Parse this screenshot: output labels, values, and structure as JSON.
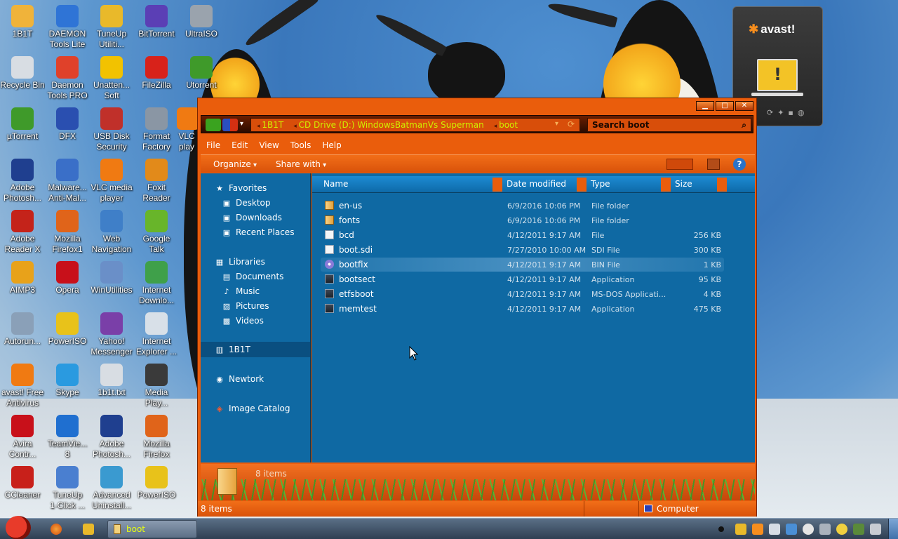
{
  "desktop_icons": [
    {
      "label": "1B1T"
    },
    {
      "label": "DAEMON\nTools Lite"
    },
    {
      "label": "TuneUp\nUtiliti..."
    },
    {
      "label": "BitTorrent"
    },
    {
      "label": "UltraISO"
    },
    {
      "label": "Recycle Bin"
    },
    {
      "label": "Daemon\nTools PRO"
    },
    {
      "label": "Unatten...\nSoft"
    },
    {
      "label": "FileZilla"
    },
    {
      "label": "Utorrent"
    },
    {
      "label": "µTorrent"
    },
    {
      "label": "DFX"
    },
    {
      "label": "USB Disk\nSecurity"
    },
    {
      "label": "Format\nFactory"
    },
    {
      "label": "VLC\nplay"
    },
    {
      "label": "Adobe\nPhotosh..."
    },
    {
      "label": "Malware...\nAnti-Mal..."
    },
    {
      "label": "VLC media\nplayer"
    },
    {
      "label": "Foxit\nReader"
    },
    {
      "label": "Adobe\nReader X"
    },
    {
      "label": "Mozilla\nFirefox1"
    },
    {
      "label": "Web\nNavigation"
    },
    {
      "label": "Google\nTalk"
    },
    {
      "label": "AIMP3"
    },
    {
      "label": "Opera"
    },
    {
      "label": "WinUtilities"
    },
    {
      "label": "Internet\nDownlo..."
    },
    {
      "label": "Autorun..."
    },
    {
      "label": "PowerISO"
    },
    {
      "label": "Yahoo!\nMessenger"
    },
    {
      "label": "Internet\nExplorer ..."
    },
    {
      "label": "avast! Free\nAntivirus"
    },
    {
      "label": "Skype"
    },
    {
      "label": "1b1t.txt"
    },
    {
      "label": "Media\nPlay..."
    },
    {
      "label": "Avira\nContr..."
    },
    {
      "label": "TeamVie...\n8"
    },
    {
      "label": "Adobe\nPhotosh..."
    },
    {
      "label": "Mozilla\nFirefox"
    },
    {
      "label": "CCleaner"
    },
    {
      "label": "TuneUp\n1-Click ..."
    },
    {
      "label": "Advanced\nUninstall..."
    },
    {
      "label": "PowerISO"
    }
  ],
  "avast_gadget": {
    "logo": "avast!"
  },
  "explorer": {
    "breadcrumb": [
      "1B1T",
      "CD Drive (D:) WindowsBatmanVs Superman",
      "boot"
    ],
    "search_placeholder": "Search boot",
    "menu": [
      "File",
      "Edit",
      "View",
      "Tools",
      "Help"
    ],
    "toolbar": {
      "organize": "Organize",
      "share_with": "Share with"
    },
    "nav": {
      "favorites": "Favorites",
      "favorites_items": [
        "Desktop",
        "Downloads",
        "Recent Places"
      ],
      "libraries": "Libraries",
      "libraries_items": [
        "Documents",
        "Music",
        "Pictures",
        "Videos"
      ],
      "computer": "1B1T",
      "network": "Newtork",
      "image_catalog": "Image Catalog"
    },
    "columns": [
      "Name",
      "Date modified",
      "Type",
      "Size"
    ],
    "files": [
      {
        "name": "en-us",
        "date": "6/9/2016 10:06 PM",
        "type": "File folder",
        "size": "",
        "icon": "folder-icon"
      },
      {
        "name": "fonts",
        "date": "6/9/2016 10:06 PM",
        "type": "File folder",
        "size": "",
        "icon": "folder-icon"
      },
      {
        "name": "bcd",
        "date": "4/12/2011 9:17 AM",
        "type": "File",
        "size": "256 KB",
        "icon": "file-icon"
      },
      {
        "name": "boot.sdi",
        "date": "7/27/2010 10:00 AM",
        "type": "SDI File",
        "size": "300 KB",
        "icon": "file-icon"
      },
      {
        "name": "bootfix",
        "date": "4/12/2011 9:17 AM",
        "type": "BIN File",
        "size": "1 KB",
        "icon": "disc-icon"
      },
      {
        "name": "bootsect",
        "date": "4/12/2011 9:17 AM",
        "type": "Application",
        "size": "95 KB",
        "icon": "app-icon"
      },
      {
        "name": "etfsboot",
        "date": "4/12/2011 9:17 AM",
        "type": "MS-DOS Applicati...",
        "size": "4 KB",
        "icon": "app-icon"
      },
      {
        "name": "memtest",
        "date": "4/12/2011 9:17 AM",
        "type": "Application",
        "size": "475 KB",
        "icon": "app-icon"
      }
    ],
    "details_count": "8 items",
    "status": {
      "count": "8 items",
      "location": "Computer"
    }
  },
  "taskbar": {
    "window_label": "boot"
  }
}
